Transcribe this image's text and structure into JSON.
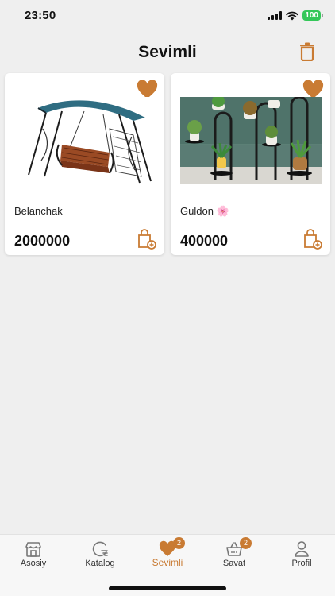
{
  "status_bar": {
    "time": "23:50",
    "battery": "100"
  },
  "header": {
    "title": "Sevimli",
    "delete_icon": "trash-icon"
  },
  "colors": {
    "accent": "#c97b33",
    "background": "#efefef",
    "card": "#ffffff",
    "battery": "#34c759"
  },
  "products": [
    {
      "name": "Belanchak",
      "price": "2000000",
      "image": "garden-swing",
      "favorite_icon": "heart-icon",
      "cart_icon": "add-to-cart-bag-icon"
    },
    {
      "name": "Guldon 🌸",
      "price": "400000",
      "image": "flower-stand",
      "favorite_icon": "heart-icon",
      "cart_icon": "add-to-cart-bag-icon"
    }
  ],
  "tabbar": {
    "items": [
      {
        "label": "Asosiy",
        "icon": "store-icon",
        "active": false
      },
      {
        "label": "Katalog",
        "icon": "catalog-icon",
        "active": false
      },
      {
        "label": "Sevimli",
        "icon": "heart-icon",
        "active": true,
        "badge": "2"
      },
      {
        "label": "Savat",
        "icon": "basket-icon",
        "active": false,
        "badge": "2"
      },
      {
        "label": "Profil",
        "icon": "user-icon",
        "active": false
      }
    ]
  }
}
